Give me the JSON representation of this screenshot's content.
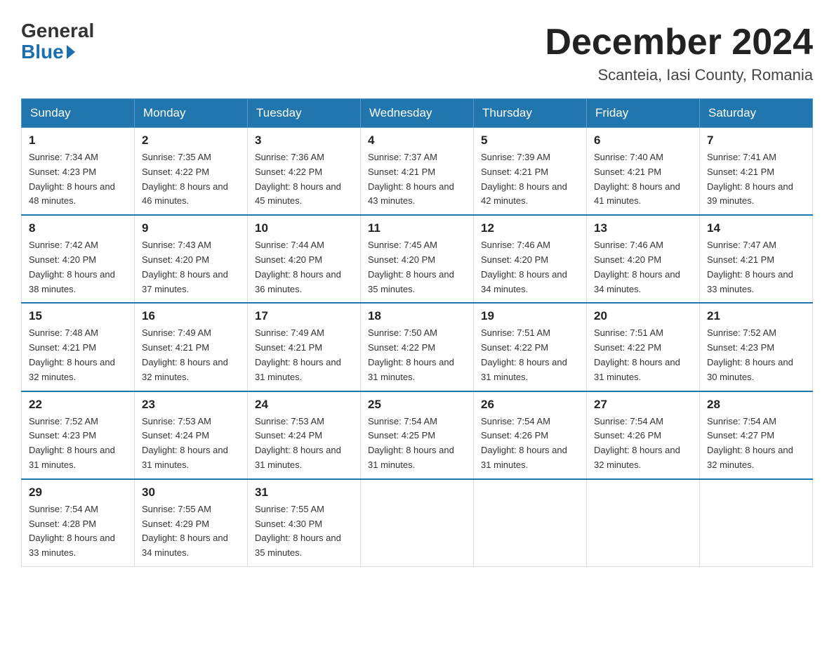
{
  "logo": {
    "general": "General",
    "blue": "Blue"
  },
  "title": "December 2024",
  "location": "Scanteia, Iasi County, Romania",
  "days_of_week": [
    "Sunday",
    "Monday",
    "Tuesday",
    "Wednesday",
    "Thursday",
    "Friday",
    "Saturday"
  ],
  "weeks": [
    [
      {
        "day": "1",
        "sunrise": "7:34 AM",
        "sunset": "4:23 PM",
        "daylight": "8 hours and 48 minutes."
      },
      {
        "day": "2",
        "sunrise": "7:35 AM",
        "sunset": "4:22 PM",
        "daylight": "8 hours and 46 minutes."
      },
      {
        "day": "3",
        "sunrise": "7:36 AM",
        "sunset": "4:22 PM",
        "daylight": "8 hours and 45 minutes."
      },
      {
        "day": "4",
        "sunrise": "7:37 AM",
        "sunset": "4:21 PM",
        "daylight": "8 hours and 43 minutes."
      },
      {
        "day": "5",
        "sunrise": "7:39 AM",
        "sunset": "4:21 PM",
        "daylight": "8 hours and 42 minutes."
      },
      {
        "day": "6",
        "sunrise": "7:40 AM",
        "sunset": "4:21 PM",
        "daylight": "8 hours and 41 minutes."
      },
      {
        "day": "7",
        "sunrise": "7:41 AM",
        "sunset": "4:21 PM",
        "daylight": "8 hours and 39 minutes."
      }
    ],
    [
      {
        "day": "8",
        "sunrise": "7:42 AM",
        "sunset": "4:20 PM",
        "daylight": "8 hours and 38 minutes."
      },
      {
        "day": "9",
        "sunrise": "7:43 AM",
        "sunset": "4:20 PM",
        "daylight": "8 hours and 37 minutes."
      },
      {
        "day": "10",
        "sunrise": "7:44 AM",
        "sunset": "4:20 PM",
        "daylight": "8 hours and 36 minutes."
      },
      {
        "day": "11",
        "sunrise": "7:45 AM",
        "sunset": "4:20 PM",
        "daylight": "8 hours and 35 minutes."
      },
      {
        "day": "12",
        "sunrise": "7:46 AM",
        "sunset": "4:20 PM",
        "daylight": "8 hours and 34 minutes."
      },
      {
        "day": "13",
        "sunrise": "7:46 AM",
        "sunset": "4:20 PM",
        "daylight": "8 hours and 34 minutes."
      },
      {
        "day": "14",
        "sunrise": "7:47 AM",
        "sunset": "4:21 PM",
        "daylight": "8 hours and 33 minutes."
      }
    ],
    [
      {
        "day": "15",
        "sunrise": "7:48 AM",
        "sunset": "4:21 PM",
        "daylight": "8 hours and 32 minutes."
      },
      {
        "day": "16",
        "sunrise": "7:49 AM",
        "sunset": "4:21 PM",
        "daylight": "8 hours and 32 minutes."
      },
      {
        "day": "17",
        "sunrise": "7:49 AM",
        "sunset": "4:21 PM",
        "daylight": "8 hours and 31 minutes."
      },
      {
        "day": "18",
        "sunrise": "7:50 AM",
        "sunset": "4:22 PM",
        "daylight": "8 hours and 31 minutes."
      },
      {
        "day": "19",
        "sunrise": "7:51 AM",
        "sunset": "4:22 PM",
        "daylight": "8 hours and 31 minutes."
      },
      {
        "day": "20",
        "sunrise": "7:51 AM",
        "sunset": "4:22 PM",
        "daylight": "8 hours and 31 minutes."
      },
      {
        "day": "21",
        "sunrise": "7:52 AM",
        "sunset": "4:23 PM",
        "daylight": "8 hours and 30 minutes."
      }
    ],
    [
      {
        "day": "22",
        "sunrise": "7:52 AM",
        "sunset": "4:23 PM",
        "daylight": "8 hours and 31 minutes."
      },
      {
        "day": "23",
        "sunrise": "7:53 AM",
        "sunset": "4:24 PM",
        "daylight": "8 hours and 31 minutes."
      },
      {
        "day": "24",
        "sunrise": "7:53 AM",
        "sunset": "4:24 PM",
        "daylight": "8 hours and 31 minutes."
      },
      {
        "day": "25",
        "sunrise": "7:54 AM",
        "sunset": "4:25 PM",
        "daylight": "8 hours and 31 minutes."
      },
      {
        "day": "26",
        "sunrise": "7:54 AM",
        "sunset": "4:26 PM",
        "daylight": "8 hours and 31 minutes."
      },
      {
        "day": "27",
        "sunrise": "7:54 AM",
        "sunset": "4:26 PM",
        "daylight": "8 hours and 32 minutes."
      },
      {
        "day": "28",
        "sunrise": "7:54 AM",
        "sunset": "4:27 PM",
        "daylight": "8 hours and 32 minutes."
      }
    ],
    [
      {
        "day": "29",
        "sunrise": "7:54 AM",
        "sunset": "4:28 PM",
        "daylight": "8 hours and 33 minutes."
      },
      {
        "day": "30",
        "sunrise": "7:55 AM",
        "sunset": "4:29 PM",
        "daylight": "8 hours and 34 minutes."
      },
      {
        "day": "31",
        "sunrise": "7:55 AM",
        "sunset": "4:30 PM",
        "daylight": "8 hours and 35 minutes."
      },
      null,
      null,
      null,
      null
    ]
  ]
}
